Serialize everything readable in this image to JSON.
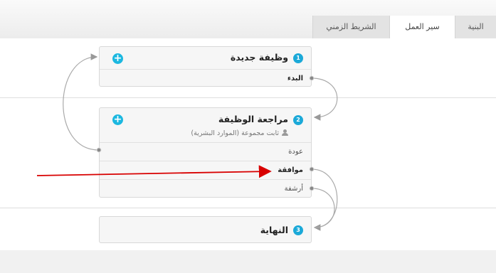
{
  "tabs": [
    {
      "label": "البنية"
    },
    {
      "label": "سير العمل"
    },
    {
      "label": "الشريط الزمني"
    }
  ],
  "nodes": [
    {
      "number": "1",
      "title": "وظيفة جديدة",
      "rows": [
        {
          "label": "البدء"
        }
      ]
    },
    {
      "number": "2",
      "title": "مراجعة الوظيفة",
      "assignee": "ثابت مجموعة (الموارد البشرية)",
      "rows": [
        {
          "label": "عودة"
        },
        {
          "label": "موافقة"
        },
        {
          "label": "أرشفة"
        }
      ]
    },
    {
      "number": "3",
      "title": "النهاية"
    }
  ],
  "colors": {
    "accent": "#1ba9d8",
    "annotation_arrow": "#d80000"
  }
}
